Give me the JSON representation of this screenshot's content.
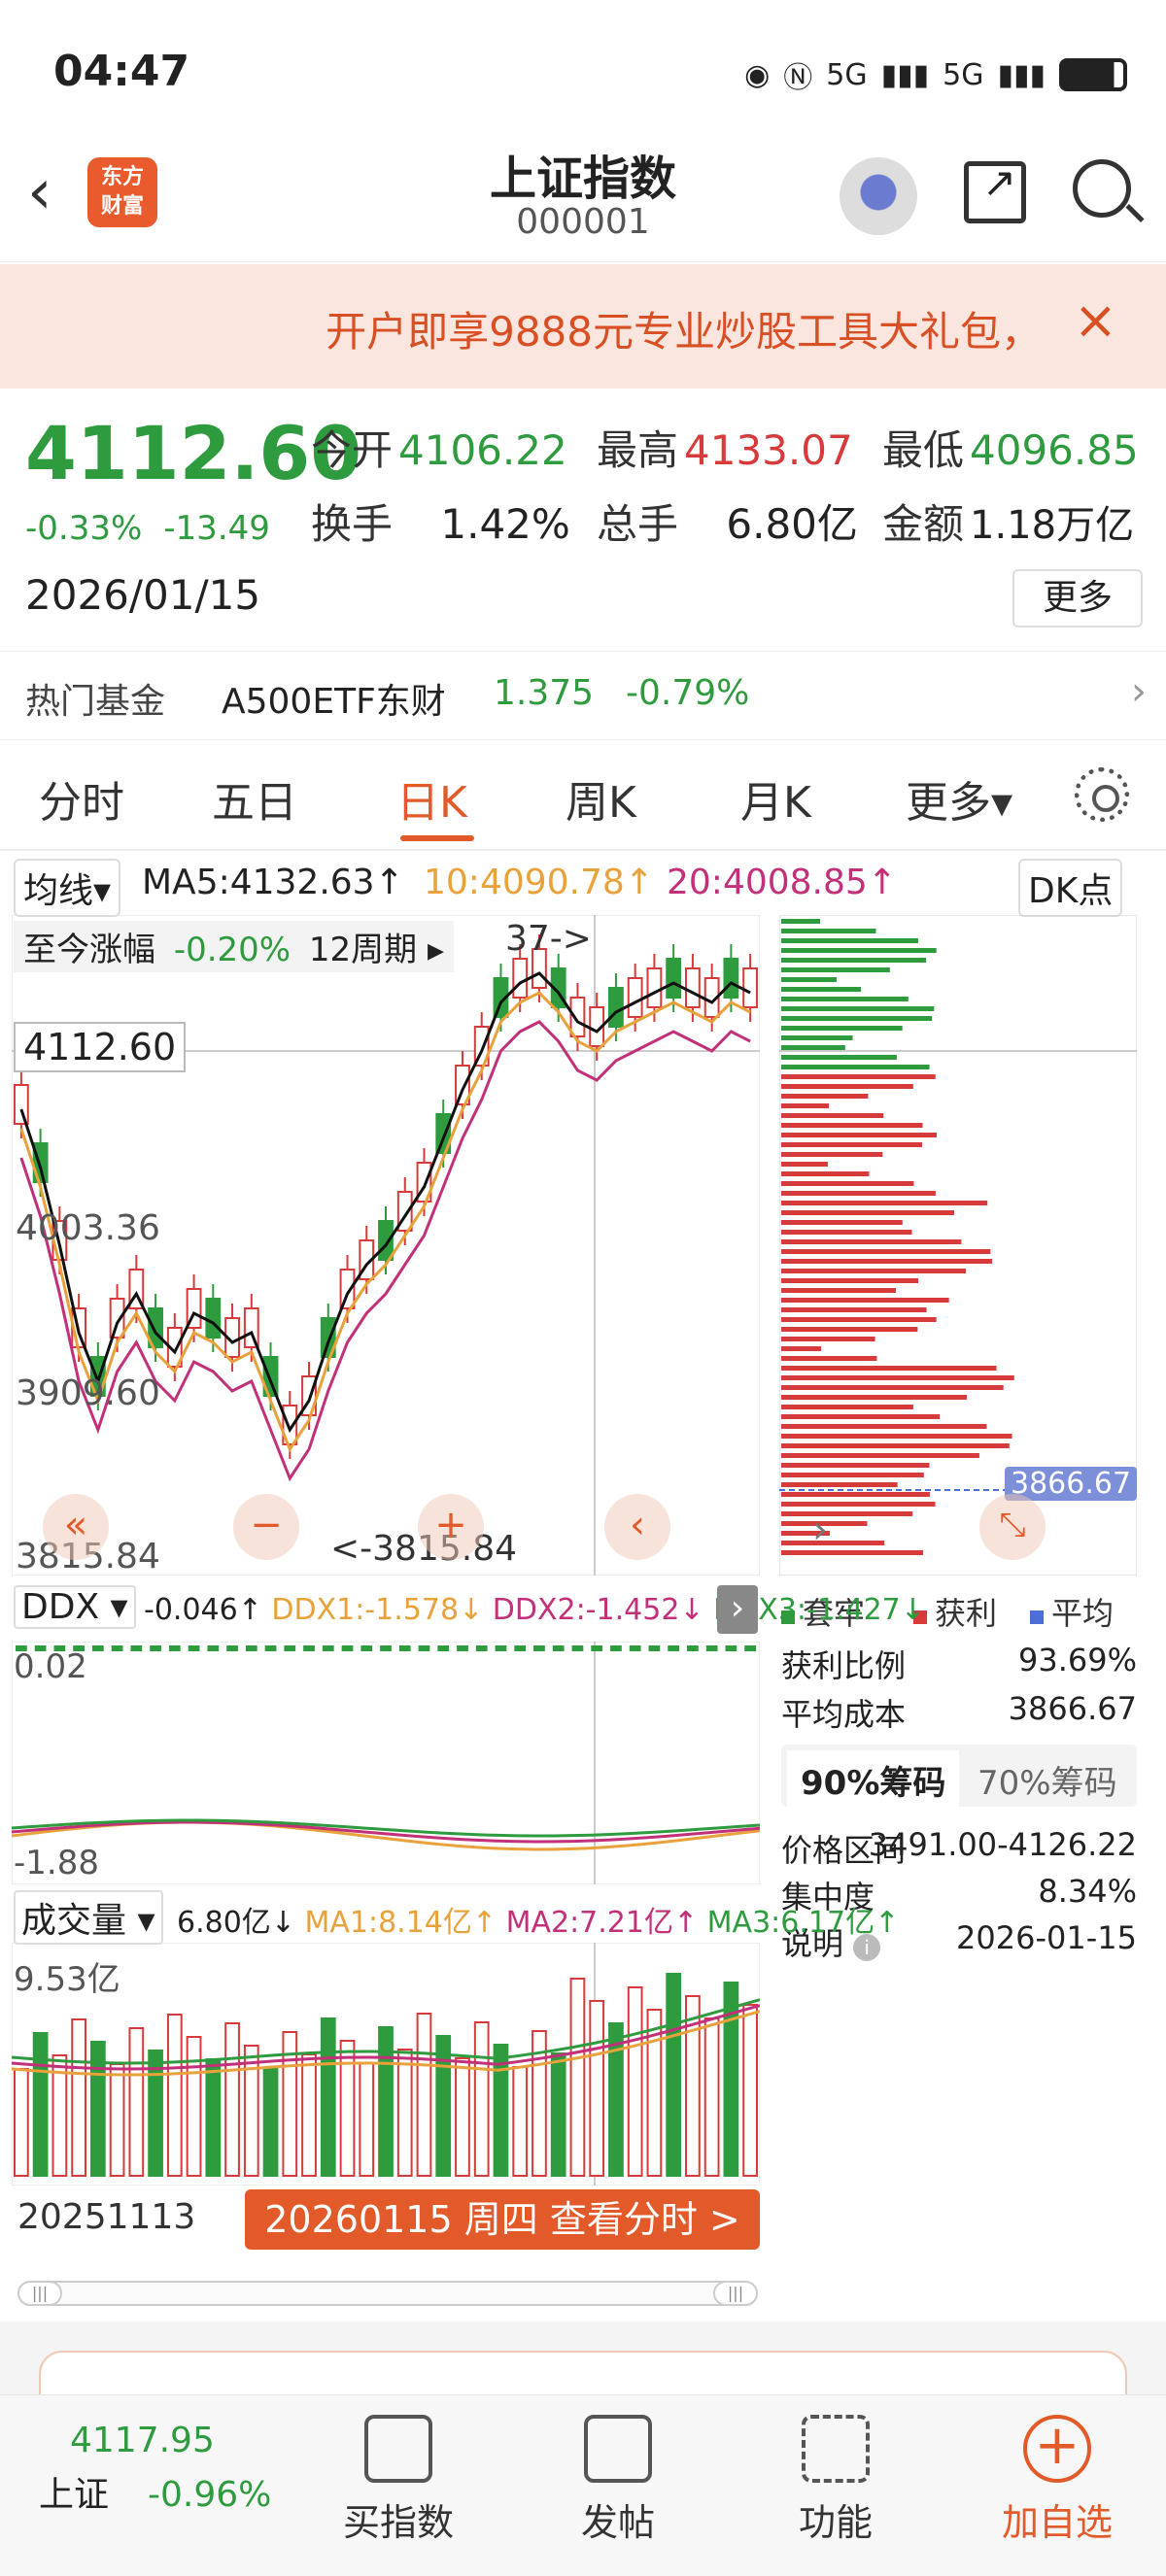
{
  "status": {
    "time": "04:47",
    "signal1": "5G",
    "signal2": "5G"
  },
  "header": {
    "logo_line1": "东方",
    "logo_line2": "财富",
    "title": "上证指数",
    "code": "000001"
  },
  "banner": {
    "text": "开户即享9888元专业炒股工具大礼包，",
    "close": "×"
  },
  "quote": {
    "price": "4112.60",
    "change_pct": "-0.33%",
    "change_abs": "-13.49",
    "date": "2026/01/15",
    "open_label": "今开",
    "open": "4106.22",
    "high_label": "最高",
    "high": "4133.07",
    "low_label": "最低",
    "low": "4096.85",
    "turnover_label": "换手",
    "turnover": "1.42%",
    "volume_label": "总手",
    "volume": "6.80亿",
    "amount_label": "金额",
    "amount": "1.18万亿",
    "more": "更多"
  },
  "hotfund": {
    "label": "热门基金",
    "name": "A500ETF东财",
    "price": "1.375",
    "pct": "-0.79%"
  },
  "tabs": [
    "分时",
    "五日",
    "日K",
    "周K",
    "月K",
    "更多▾"
  ],
  "active_tab": 2,
  "ma": {
    "selector": "均线▾",
    "ma5": "MA5:4132.63↑",
    "ma10": "10:4090.78↑",
    "ma20": "20:4008.85↑",
    "dk": "DK点"
  },
  "kline": {
    "period_label": "至今涨幅",
    "period_pct": "-0.20%",
    "period_len": "12周期 ▸",
    "current_price": "4112.60",
    "high_marker": "37->",
    "low_marker": "<-3815.84",
    "y_ticks": [
      "4003.36",
      "3909.60",
      "3815.84"
    ],
    "colors": {
      "up": "#d63a3a",
      "down": "#2e9b3e",
      "ma5": "#111111",
      "ma10": "#e9a23b",
      "ma20": "#c2307a"
    }
  },
  "chip": {
    "cost_marker": "3866.67",
    "legend": {
      "trapped": "套牢",
      "profit": "获利",
      "avg": "平均"
    },
    "profit_ratio_label": "获利比例",
    "profit_ratio": "93.69%",
    "avg_cost_label": "平均成本",
    "avg_cost": "3866.67",
    "tab90": "90%筹码",
    "tab70": "70%筹码",
    "range_label": "价格区间",
    "range": "3491.00-4126.22",
    "concentration_label": "集中度",
    "concentration": "8.34%",
    "note_label": "说明",
    "note_date": "2026-01-15"
  },
  "ddx": {
    "selector": "DDX ▾",
    "val": "-0.046↑",
    "ddx1": "DDX1:-1.578↓",
    "ddx2": "DDX2:-1.452↓",
    "ddx3": "DDX3:-1.427↓",
    "top": "0.02",
    "bottom": "-1.88"
  },
  "vol": {
    "selector": "成交量 ▾",
    "val": "6.80亿↓",
    "ma1": "MA1:8.14亿↑",
    "ma2": "MA2:7.21亿↑",
    "ma3": "MA3:6.17亿↑",
    "top": "9.53亿"
  },
  "dates": {
    "start": "20251113",
    "current": "20260115 周四 查看分时 >"
  },
  "navbar": {
    "mini_price": "4117.95",
    "mini_name": "上证",
    "mini_pct": "-0.96%",
    "items": [
      "买指数",
      "发帖",
      "功能",
      "加自选"
    ]
  }
}
